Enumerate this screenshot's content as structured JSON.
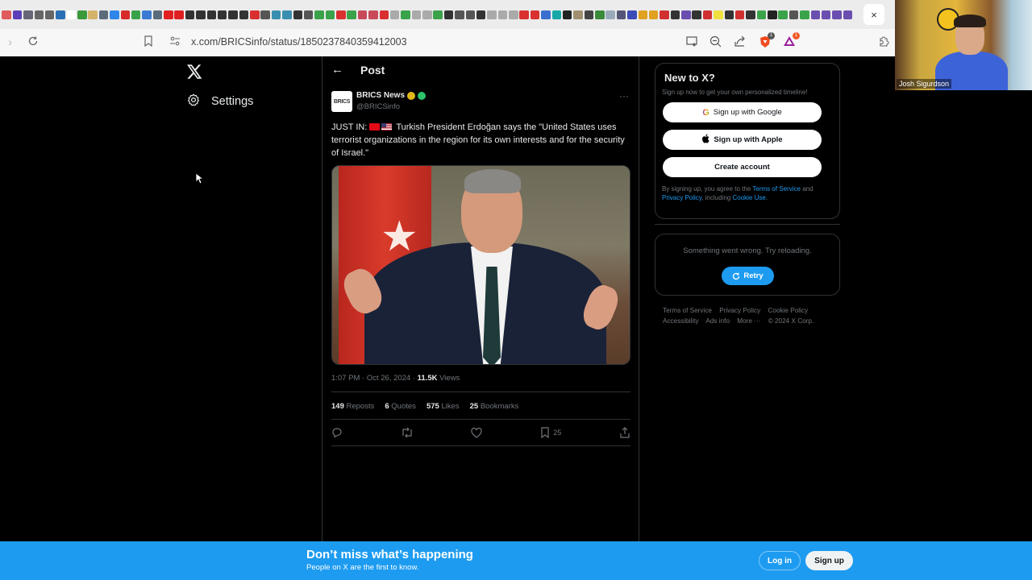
{
  "browser": {
    "bookmark_colors": [
      "#e05b5b",
      "#5b3fb8",
      "#667",
      "#666",
      "#666",
      "#2a6fb3",
      "#fff",
      "#3a9a3a",
      "#d4b36a",
      "#5b6b7b",
      "#2f86e8",
      "#d72b2b",
      "#3aa34a",
      "#3b7bd4",
      "#5b6b7b",
      "#e02020",
      "#e02020",
      "#333",
      "#333",
      "#333",
      "#333",
      "#333",
      "#333",
      "#d93030",
      "#555",
      "#3a8fb0",
      "#3a8fb0",
      "#333",
      "#555",
      "#3aa34a",
      "#3aa34a",
      "#d93030",
      "#3aa34a",
      "#c84a5a",
      "#c84a5a",
      "#d93030",
      "#aaa",
      "#3aa34a",
      "#aaa",
      "#aaa",
      "#3aa34a",
      "#333",
      "#555",
      "#555",
      "#333",
      "#aaa",
      "#aaa",
      "#aaa",
      "#d93030",
      "#d93030",
      "#3a6fd0",
      "#18a8a8",
      "#222",
      "#a09070",
      "#444",
      "#3a8a3a",
      "#9ab",
      "#557",
      "#3b4bb8",
      "#e0a020",
      "#e0a020",
      "#d03030",
      "#333",
      "#6a4fb0",
      "#333",
      "#d03030",
      "#f0e040",
      "#333",
      "#d03030",
      "#333",
      "#3aa34a",
      "#222",
      "#3aa34a",
      "#555",
      "#3aa34a",
      "#6a4fb0",
      "#6a4fb0",
      "#6a4fb0",
      "#6a4fb0"
    ],
    "close_tab_label": "×",
    "url": "x.com/BRICSinfo/status/1850237840359412003",
    "brave_badge": "1",
    "rewards_badge": "1"
  },
  "webcam": {
    "name": "Josh Sigurdson"
  },
  "nav": {
    "settings_label": "Settings"
  },
  "post": {
    "header_title": "Post",
    "author_name": "BRICS News",
    "author_handle": "@BRICSinfo",
    "avatar_text": "BRICS",
    "text_prefix": "JUST IN:",
    "text_body": "Turkish President Erdoğan says the \"United States uses terrorist organizations in the region for its own interests and for the security of Israel.\"",
    "time": "1:07 PM · Oct 26, 2024 ·",
    "views_count": "11.5K",
    "views_label": "Views",
    "stats": [
      {
        "count": "149",
        "label": "Reposts"
      },
      {
        "count": "6",
        "label": "Quotes"
      },
      {
        "count": "575",
        "label": "Likes"
      },
      {
        "count": "25",
        "label": "Bookmarks"
      }
    ],
    "bookmark_count": "25"
  },
  "sidebar": {
    "new_title": "New to X?",
    "new_sub": "Sign up now to get your own personalized timeline!",
    "google_label": "Sign up with Google",
    "apple_label": "Sign up with Apple",
    "create_label": "Create account",
    "legal_1": "By signing up, you agree to the",
    "legal_tos": "Terms of Service",
    "legal_and": "and",
    "legal_pp": "Privacy Policy",
    "legal_incl": ", including",
    "legal_cookie": "Cookie Use",
    "legal_end": ".",
    "error_msg": "Something went wrong. Try reloading.",
    "retry_label": "Retry",
    "footer": [
      "Terms of Service",
      "Privacy Policy",
      "Cookie Policy",
      "Accessibility",
      "Ads info",
      "More ···",
      "© 2024 X Corp."
    ]
  },
  "bottom": {
    "title": "Don’t miss what’s happening",
    "subtitle": "People on X are the first to know.",
    "login_label": "Log in",
    "signup_label": "Sign up"
  },
  "colors": {
    "accent": "#1d9bf0",
    "background": "#000000",
    "border": "#2f3336",
    "text_primary": "#e7e9ea",
    "text_secondary": "#71767b"
  }
}
